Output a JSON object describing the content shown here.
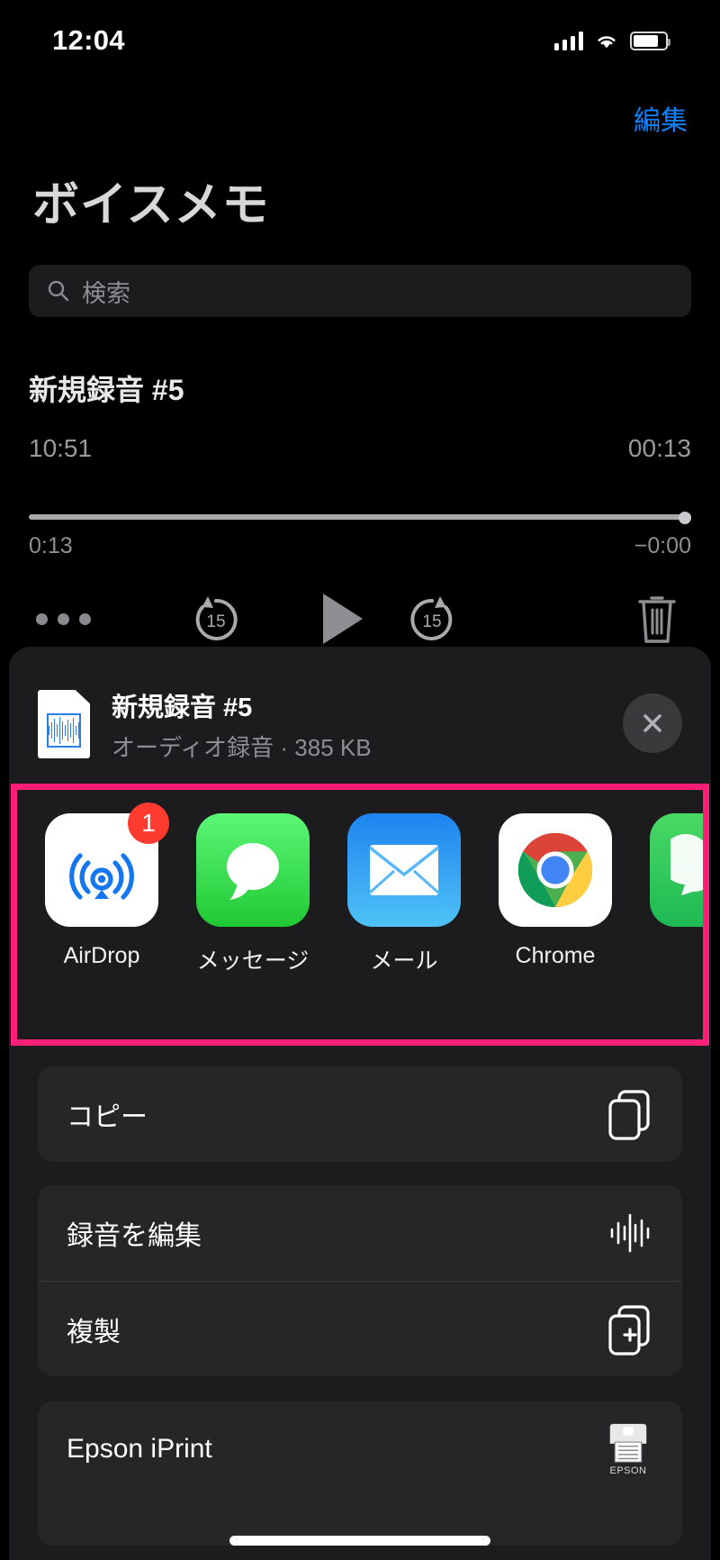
{
  "status_bar": {
    "time": "12:04",
    "cellular_icon": "cellular-bars-icon",
    "wifi_icon": "wifi-icon",
    "battery_icon": "battery-icon"
  },
  "nav": {
    "edit_label": "編集"
  },
  "header": {
    "title": "ボイスメモ"
  },
  "search": {
    "placeholder": "検索",
    "value": "",
    "icon": "search-icon"
  },
  "recording": {
    "name": "新規録音 #5",
    "timestamp": "10:51",
    "duration": "00:13",
    "elapsed": "0:13",
    "remaining": "−0:00",
    "progress_percent": 100
  },
  "transport": {
    "more_label": "•••",
    "skip_back_label": "15",
    "play_label": "play",
    "skip_forward_label": "15",
    "delete_label": "trash"
  },
  "share_sheet": {
    "file": {
      "name": "新規録音 #5",
      "subtitle": "オーディオ録音 · 385 KB"
    },
    "close_label": "✕",
    "highlight_color": "#ff1f77",
    "apps": [
      {
        "label": "AirDrop",
        "icon": "airdrop-icon",
        "badge": "1"
      },
      {
        "label": "メッセージ",
        "icon": "messages-icon",
        "badge": ""
      },
      {
        "label": "メール",
        "icon": "mail-icon",
        "badge": ""
      },
      {
        "label": "Chrome",
        "icon": "chrome-icon",
        "badge": ""
      },
      {
        "label": "",
        "icon": "whatsapp-icon",
        "badge": ""
      }
    ],
    "action_groups": [
      {
        "rows": [
          {
            "label": "コピー",
            "icon": "copy-icon"
          }
        ]
      },
      {
        "rows": [
          {
            "label": "録音を編集",
            "icon": "waveform-icon"
          },
          {
            "label": "複製",
            "icon": "duplicate-icon"
          }
        ]
      },
      {
        "rows": [
          {
            "label": "Epson iPrint",
            "icon": "epson-printer-icon",
            "brand": "EPSON"
          }
        ]
      }
    ]
  }
}
